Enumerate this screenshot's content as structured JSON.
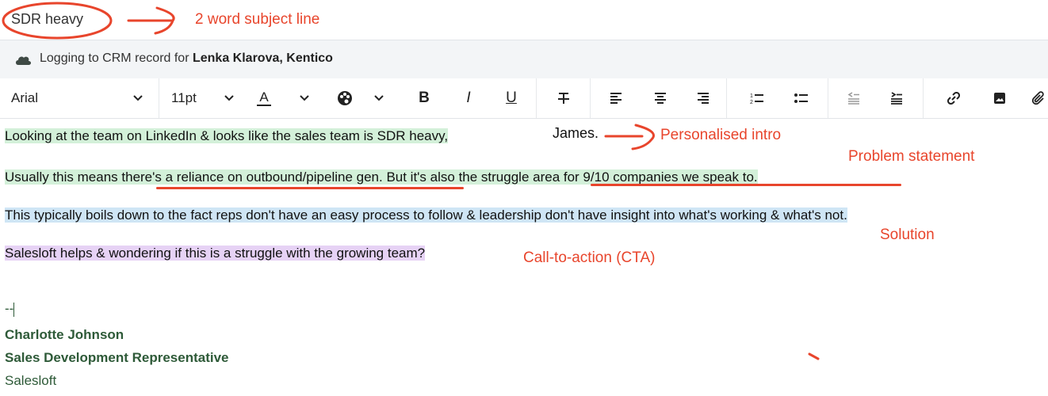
{
  "subject": {
    "value": "SDR heavy"
  },
  "crm": {
    "prefix": "Logging to CRM record for ",
    "contact": "Lenka Klarova",
    "separator": ", ",
    "company": "Kentico"
  },
  "toolbar": {
    "font": "Arial",
    "size": "11pt",
    "text_color_label": "A",
    "bold_label": "B",
    "italic_label": "I",
    "underline_label": "U",
    "chevron": "⌄"
  },
  "email_body": {
    "line1": "Looking at the team on LinkedIn & looks like the sales team is SDR heavy,",
    "line1_name": "James.",
    "line2_pre": "Usually this means ",
    "line2_u1": "there's a reliance on outbound/pipeline gen",
    "line2_mid": ". But it's also the ",
    "line2_u2": "struggle area for 9/10 companies we speak",
    "line2_post": " to.",
    "line3": "This typically boils down to the fact reps don't have an easy process to follow & leadership don't have insight into what's working & what's not.",
    "line4": "Salesloft helps & wondering if this is a struggle with the growing team?"
  },
  "signature": {
    "dashes": "--",
    "name": "Charlotte Johnson",
    "title": "Sales Development Representative",
    "company": "Salesloft"
  },
  "annotations": {
    "subject_note": "2 word subject line",
    "intro_note": "Personalised intro",
    "problem_note": "Problem statement",
    "solution_note": "Solution",
    "cta_note": "Call-to-action (CTA)"
  },
  "colors": {
    "annotation": "#e8452c",
    "highlight_green": "#d3f0d9",
    "highlight_blue": "#cfe5f5",
    "highlight_purple": "#e6d2f5",
    "signature": "#2e5a38"
  }
}
